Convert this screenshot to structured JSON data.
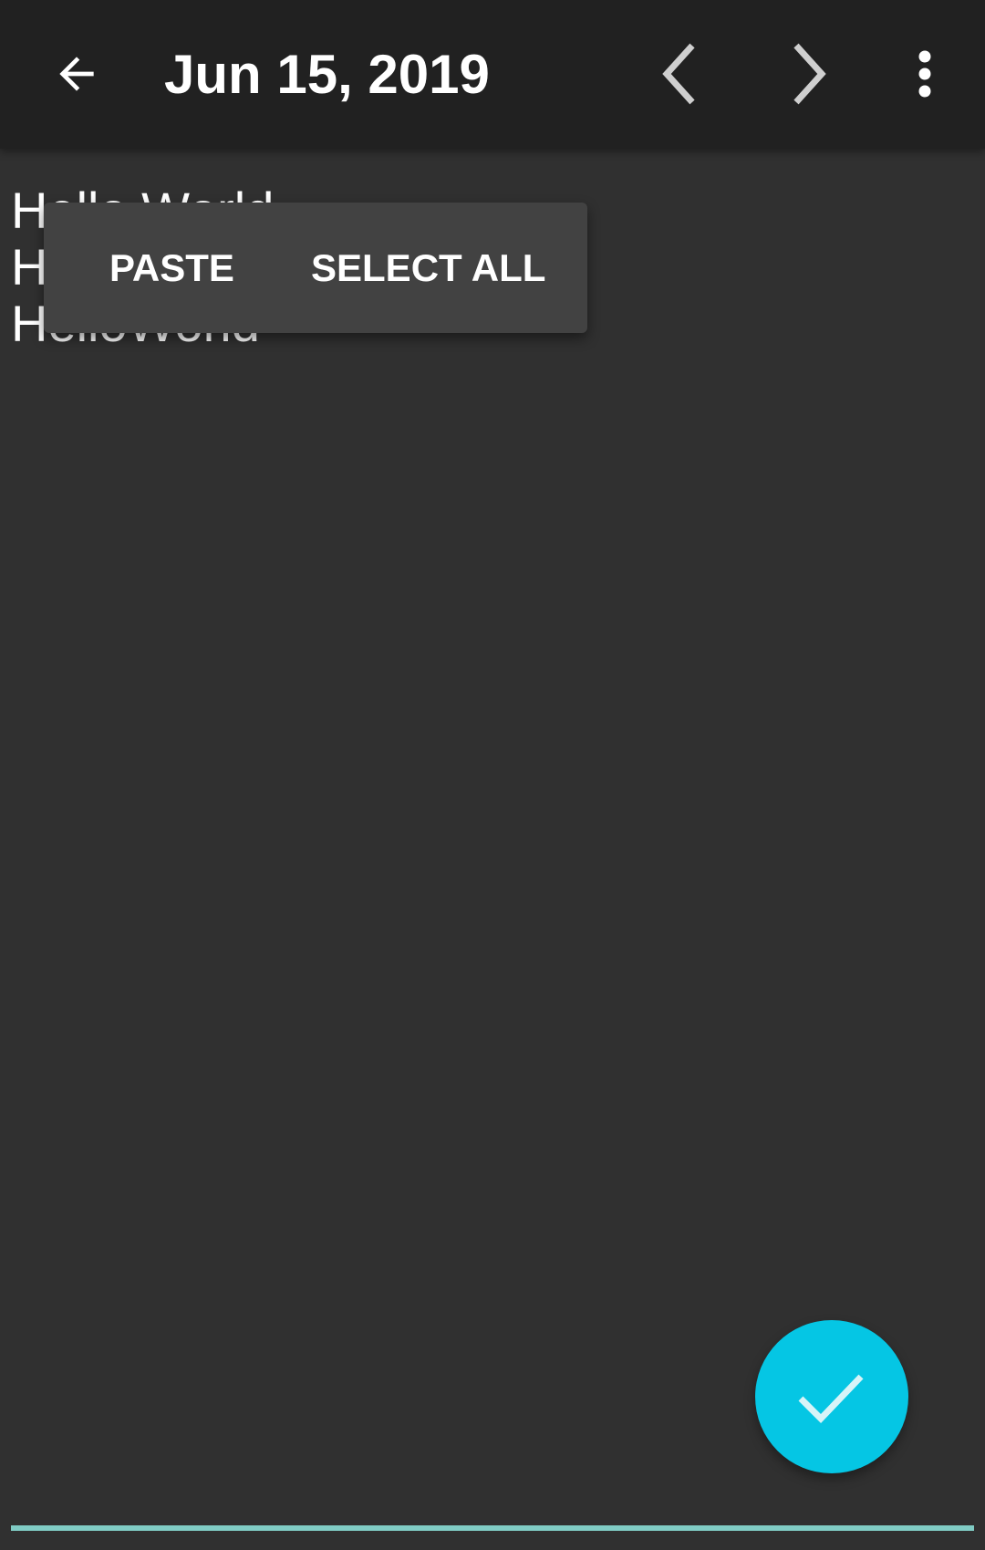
{
  "toolbar": {
    "title": "Jun 15, 2019",
    "back_icon": "arrow-left-icon",
    "prev_icon": "chevron-left-icon",
    "next_icon": "chevron-right-icon",
    "menu_icon": "more-vert-icon",
    "background_color": "#212121"
  },
  "editor": {
    "lines": [
      "Hello World",
      "Hello World",
      "HelloWorld"
    ],
    "text_color": "#ffffff",
    "background_color": "#303030",
    "underline_color": "#80cbc4"
  },
  "context_menu": {
    "items": [
      "PASTE",
      "SELECT ALL"
    ],
    "background_color": "#424242"
  },
  "fab": {
    "icon": "check-icon",
    "color": "#05c6e4"
  }
}
